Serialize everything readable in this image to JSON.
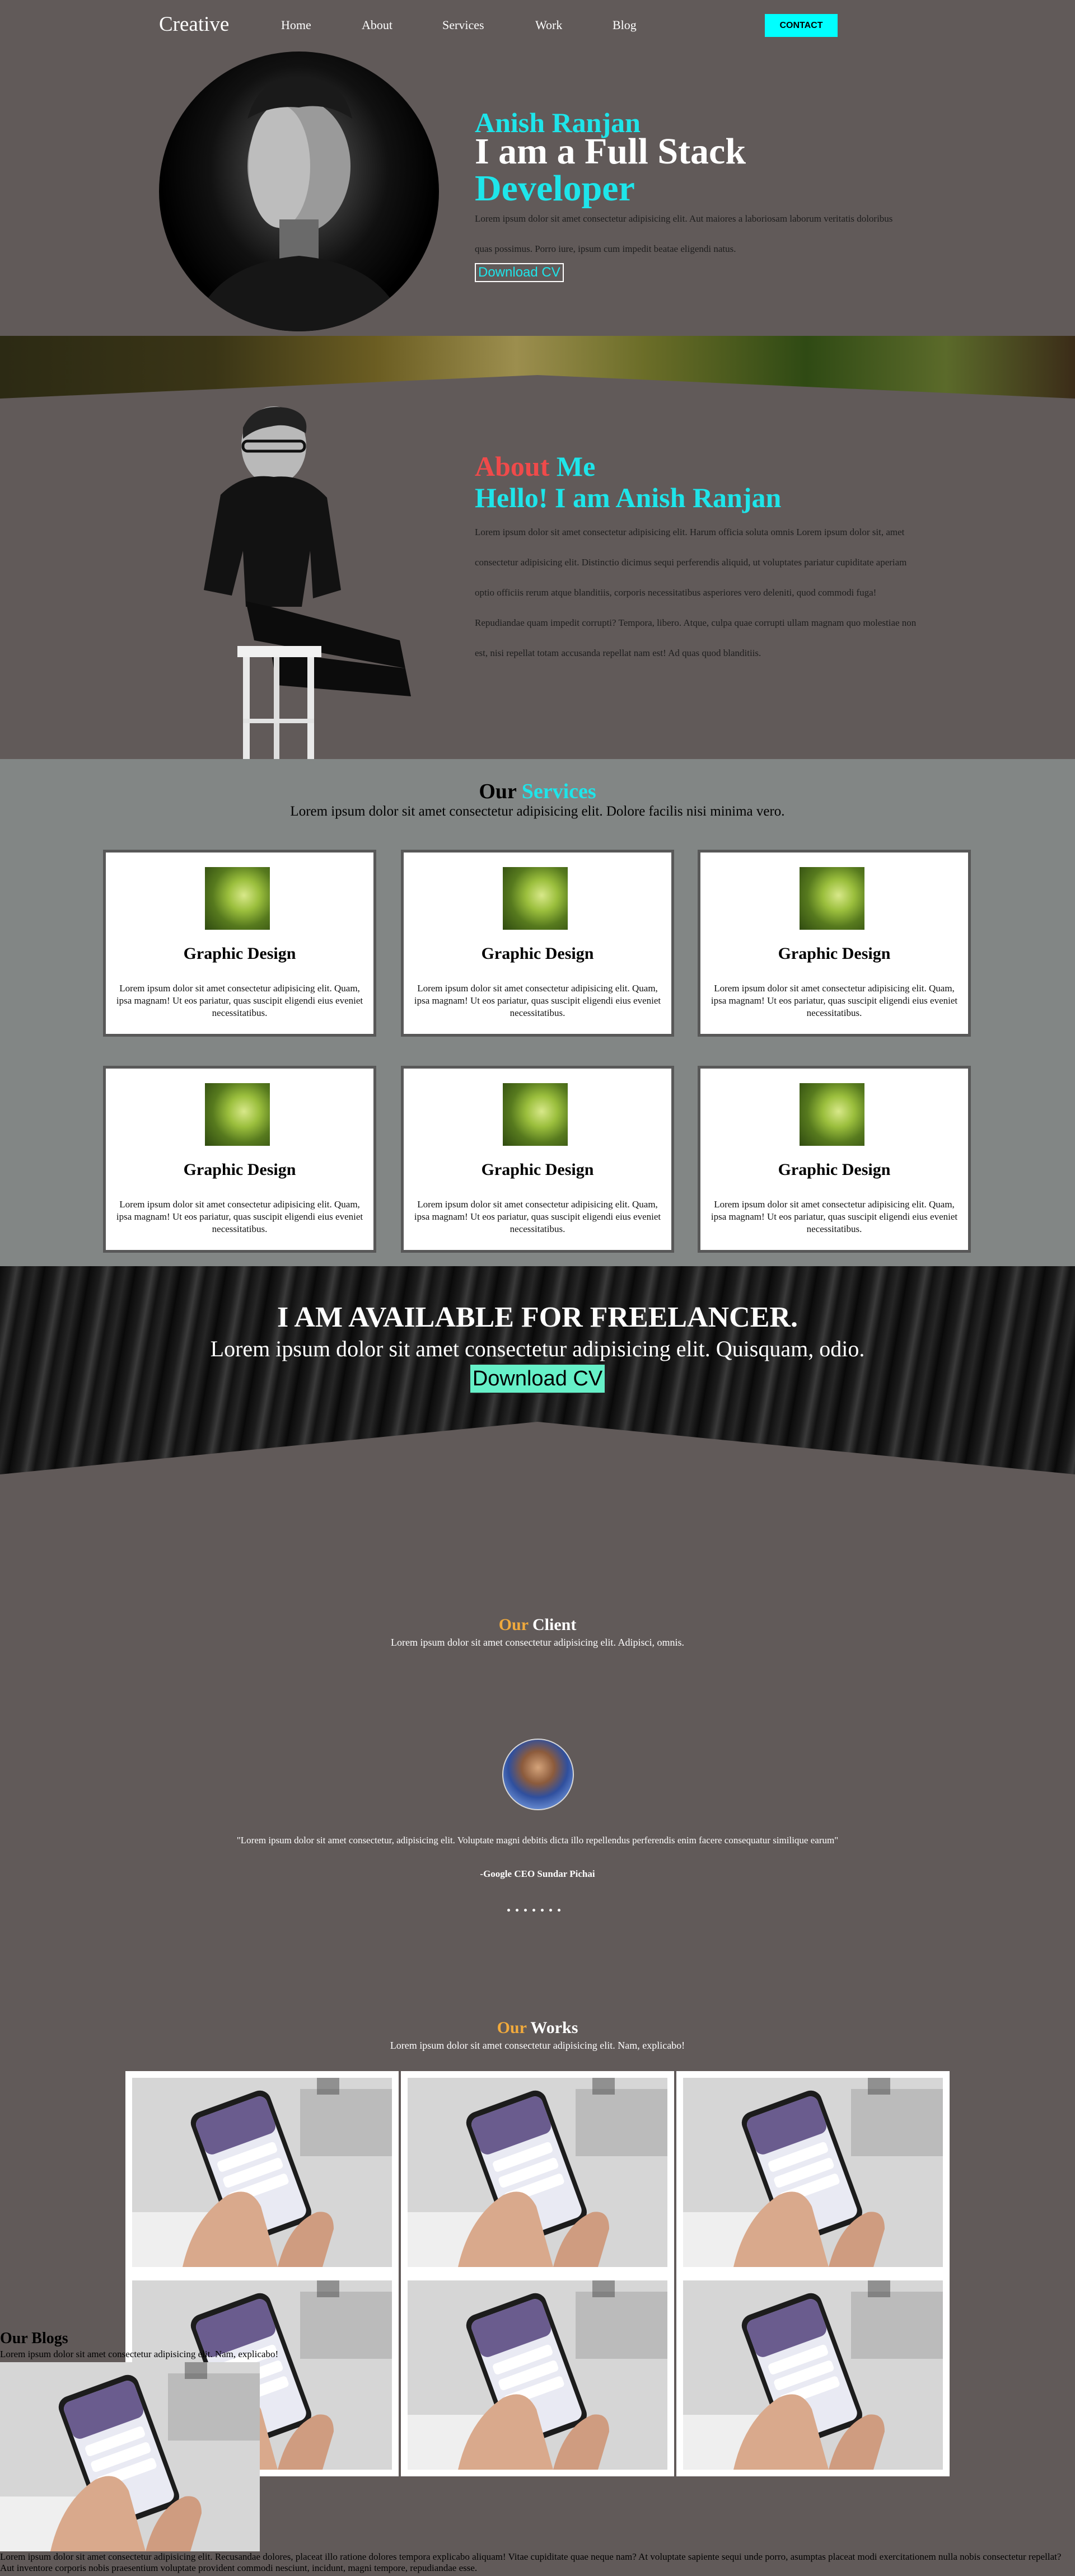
{
  "nav": {
    "brand": "Creative",
    "links": [
      "Home",
      "About",
      "Services",
      "Work",
      "Blog"
    ],
    "contact_label": "CONTACT"
  },
  "hero": {
    "name": "Anish Ranjan",
    "headline_1": "I am a Full Stack",
    "headline_2": "Developer",
    "paragraph": "Lorem ipsum dolor sit amet consectetur adipisicing elit. Aut maiores a laboriosam laborum veritatis doloribus quas possimus. Porro iure, ipsum cum impedit beatae eligendi natus.",
    "cv_label": "Download CV"
  },
  "about": {
    "title_1": "About",
    "title_2": "Me",
    "subtitle": "Hello! I am Anish Ranjan",
    "paragraph": "Lorem ipsum dolor sit amet consectetur adipisicing elit. Harum officia soluta omnis Lorem ipsum dolor sit, amet consectetur adipisicing elit. Distinctio dicimus sequi perferendis aliquid, ut voluptates pariatur cupiditate aperiam optio officiis rerum atque blanditiis, corporis necessitatibus asperiores vero deleniti, quod commodi fuga! Repudiandae quam impedit corrupti? Tempora, libero. Atque, culpa quae corrupti ullam magnam quo molestiae non est, nisi repellat totam accusanda repellat nam est! Ad quas quod blanditiis."
  },
  "services": {
    "title_1": "Our",
    "title_2": "Services",
    "subtitle": "Lorem ipsum dolor sit amet consectetur adipisicing elit. Dolore facilis nisi minima vero.",
    "cards": [
      {
        "title": "Graphic Design",
        "text": "Lorem ipsum dolor sit amet consectetur adipisicing elit. Quam, ipsa magnam! Ut eos pariatur, quas suscipit eligendi eius eveniet necessitatibus."
      },
      {
        "title": "Graphic Design",
        "text": "Lorem ipsum dolor sit amet consectetur adipisicing elit. Quam, ipsa magnam! Ut eos pariatur, quas suscipit eligendi eius eveniet necessitatibus."
      },
      {
        "title": "Graphic Design",
        "text": "Lorem ipsum dolor sit amet consectetur adipisicing elit. Quam, ipsa magnam! Ut eos pariatur, quas suscipit eligendi eius eveniet necessitatibus."
      },
      {
        "title": "Graphic Design",
        "text": "Lorem ipsum dolor sit amet consectetur adipisicing elit. Quam, ipsa magnam! Ut eos pariatur, quas suscipit eligendi eius eveniet necessitatibus."
      },
      {
        "title": "Graphic Design",
        "text": "Lorem ipsum dolor sit amet consectetur adipisicing elit. Quam, ipsa magnam! Ut eos pariatur, quas suscipit eligendi eius eveniet necessitatibus."
      },
      {
        "title": "Graphic Design",
        "text": "Lorem ipsum dolor sit amet consectetur adipisicing elit. Quam, ipsa magnam! Ut eos pariatur, quas suscipit eligendi eius eveniet necessitatibus."
      }
    ]
  },
  "freelance": {
    "title": "I AM AVAILABLE FOR FREELANCER.",
    "subtitle": "Lorem ipsum dolor sit amet consectetur adipisicing elit. Quisquam, odio.",
    "button_label": "Download CV"
  },
  "client": {
    "title_1": "Our",
    "title_2": "Client",
    "subtitle": "Lorem ipsum dolor sit amet consectetur adipisicing elit. Adipisci, omnis.",
    "quote": "\"Lorem ipsum dolor sit amet consectetur, adipisicing elit. Voluptate magni debitis dicta illo repellendus perferendis enim facere consequatur similique earum\"",
    "author": "-Google CEO Sundar Pichai",
    "dot_count": 7
  },
  "works": {
    "title_1": "Our",
    "title_2": "Works",
    "subtitle": "Lorem ipsum dolor sit amet consectetur adipisicing elit. Nam, explicabo!",
    "tile_count": 6
  },
  "blogs": {
    "title": "Our Blogs",
    "subtitle": "Lorem ipsum dolor sit amet consectetur adipisicing elit. Nam, explicabo!",
    "text": "Lorem ipsum dolor sit amet consectetur adipisicing elit. Recusandae dolores, placeat illo ratione dolores tempora explicabo aliquam! Vitae cupiditate quae neque nam? At voluptate sapiente sequi unde porro, asumptas placeat modi exercitationem nulla nobis consectetur repellat? Aut inventore corporis nobis praesentium voluptate provident commodi nesciunt, incidunt, magni tempore, repudiandae esse."
  },
  "colors": {
    "background": "#615a59",
    "accent_cyan": "#1ee5ea",
    "accent_red": "#f04a4a",
    "accent_orange": "#f1aa3c",
    "services_bg": "#828685",
    "download_btn": "#66f0c8"
  }
}
